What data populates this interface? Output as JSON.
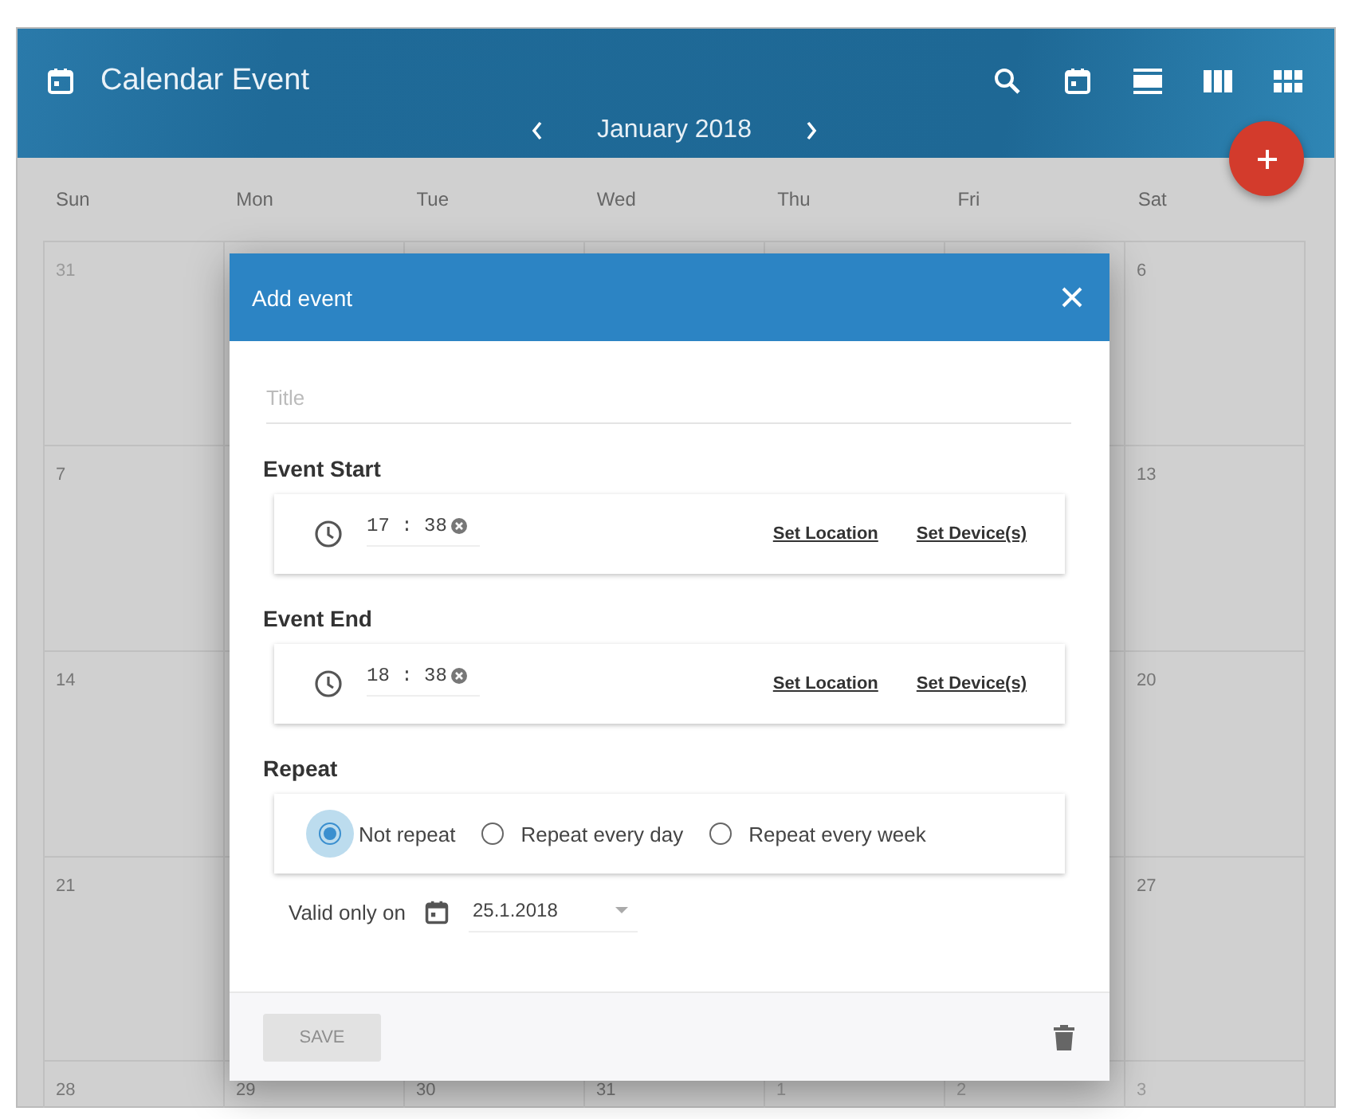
{
  "app": {
    "title": "Calendar Event",
    "month": "January 2018"
  },
  "weekdays": [
    "Sun",
    "Mon",
    "Tue",
    "Wed",
    "Thu",
    "Fri",
    "Sat"
  ],
  "weeks": [
    {
      "sun": {
        "day": "31",
        "muted": true
      },
      "sat": {
        "day": "6",
        "muted": false
      }
    },
    {
      "sun": {
        "day": "7",
        "muted": false
      },
      "sat": {
        "day": "13",
        "muted": false
      }
    },
    {
      "sun": {
        "day": "14",
        "muted": false
      },
      "sat": {
        "day": "20",
        "muted": false
      }
    },
    {
      "sun": {
        "day": "21",
        "muted": false
      },
      "sat": {
        "day": "27",
        "muted": false
      }
    },
    {
      "sun": {
        "day": "28",
        "muted": false
      },
      "mon": {
        "day": "29",
        "muted": false
      },
      "tue": {
        "day": "30",
        "muted": false
      },
      "wed": {
        "day": "31",
        "muted": false
      },
      "thu": {
        "day": "1",
        "muted": true
      },
      "fri": {
        "day": "2",
        "muted": true
      },
      "sat": {
        "day": "3",
        "muted": true
      }
    }
  ],
  "dialog": {
    "title": "Add event",
    "title_field": {
      "placeholder": "Title"
    },
    "times": [
      {
        "heading": "Event Start",
        "time": "17 : 38",
        "links": [
          "Set Location",
          "Set Device(s)"
        ]
      },
      {
        "heading": "Event End",
        "time": "18 : 38",
        "links": [
          "Set Location",
          "Set Device(s)"
        ]
      }
    ],
    "repeat": {
      "heading": "Repeat",
      "options": [
        {
          "label": "Not repeat",
          "selected": true
        },
        {
          "label": "Repeat every day",
          "selected": false
        },
        {
          "label": "Repeat every week",
          "selected": false
        }
      ]
    },
    "valid_only": {
      "label": "Valid only on",
      "date": "25.1.2018"
    },
    "save": {
      "label": "SAVE",
      "disabled": true
    }
  }
}
